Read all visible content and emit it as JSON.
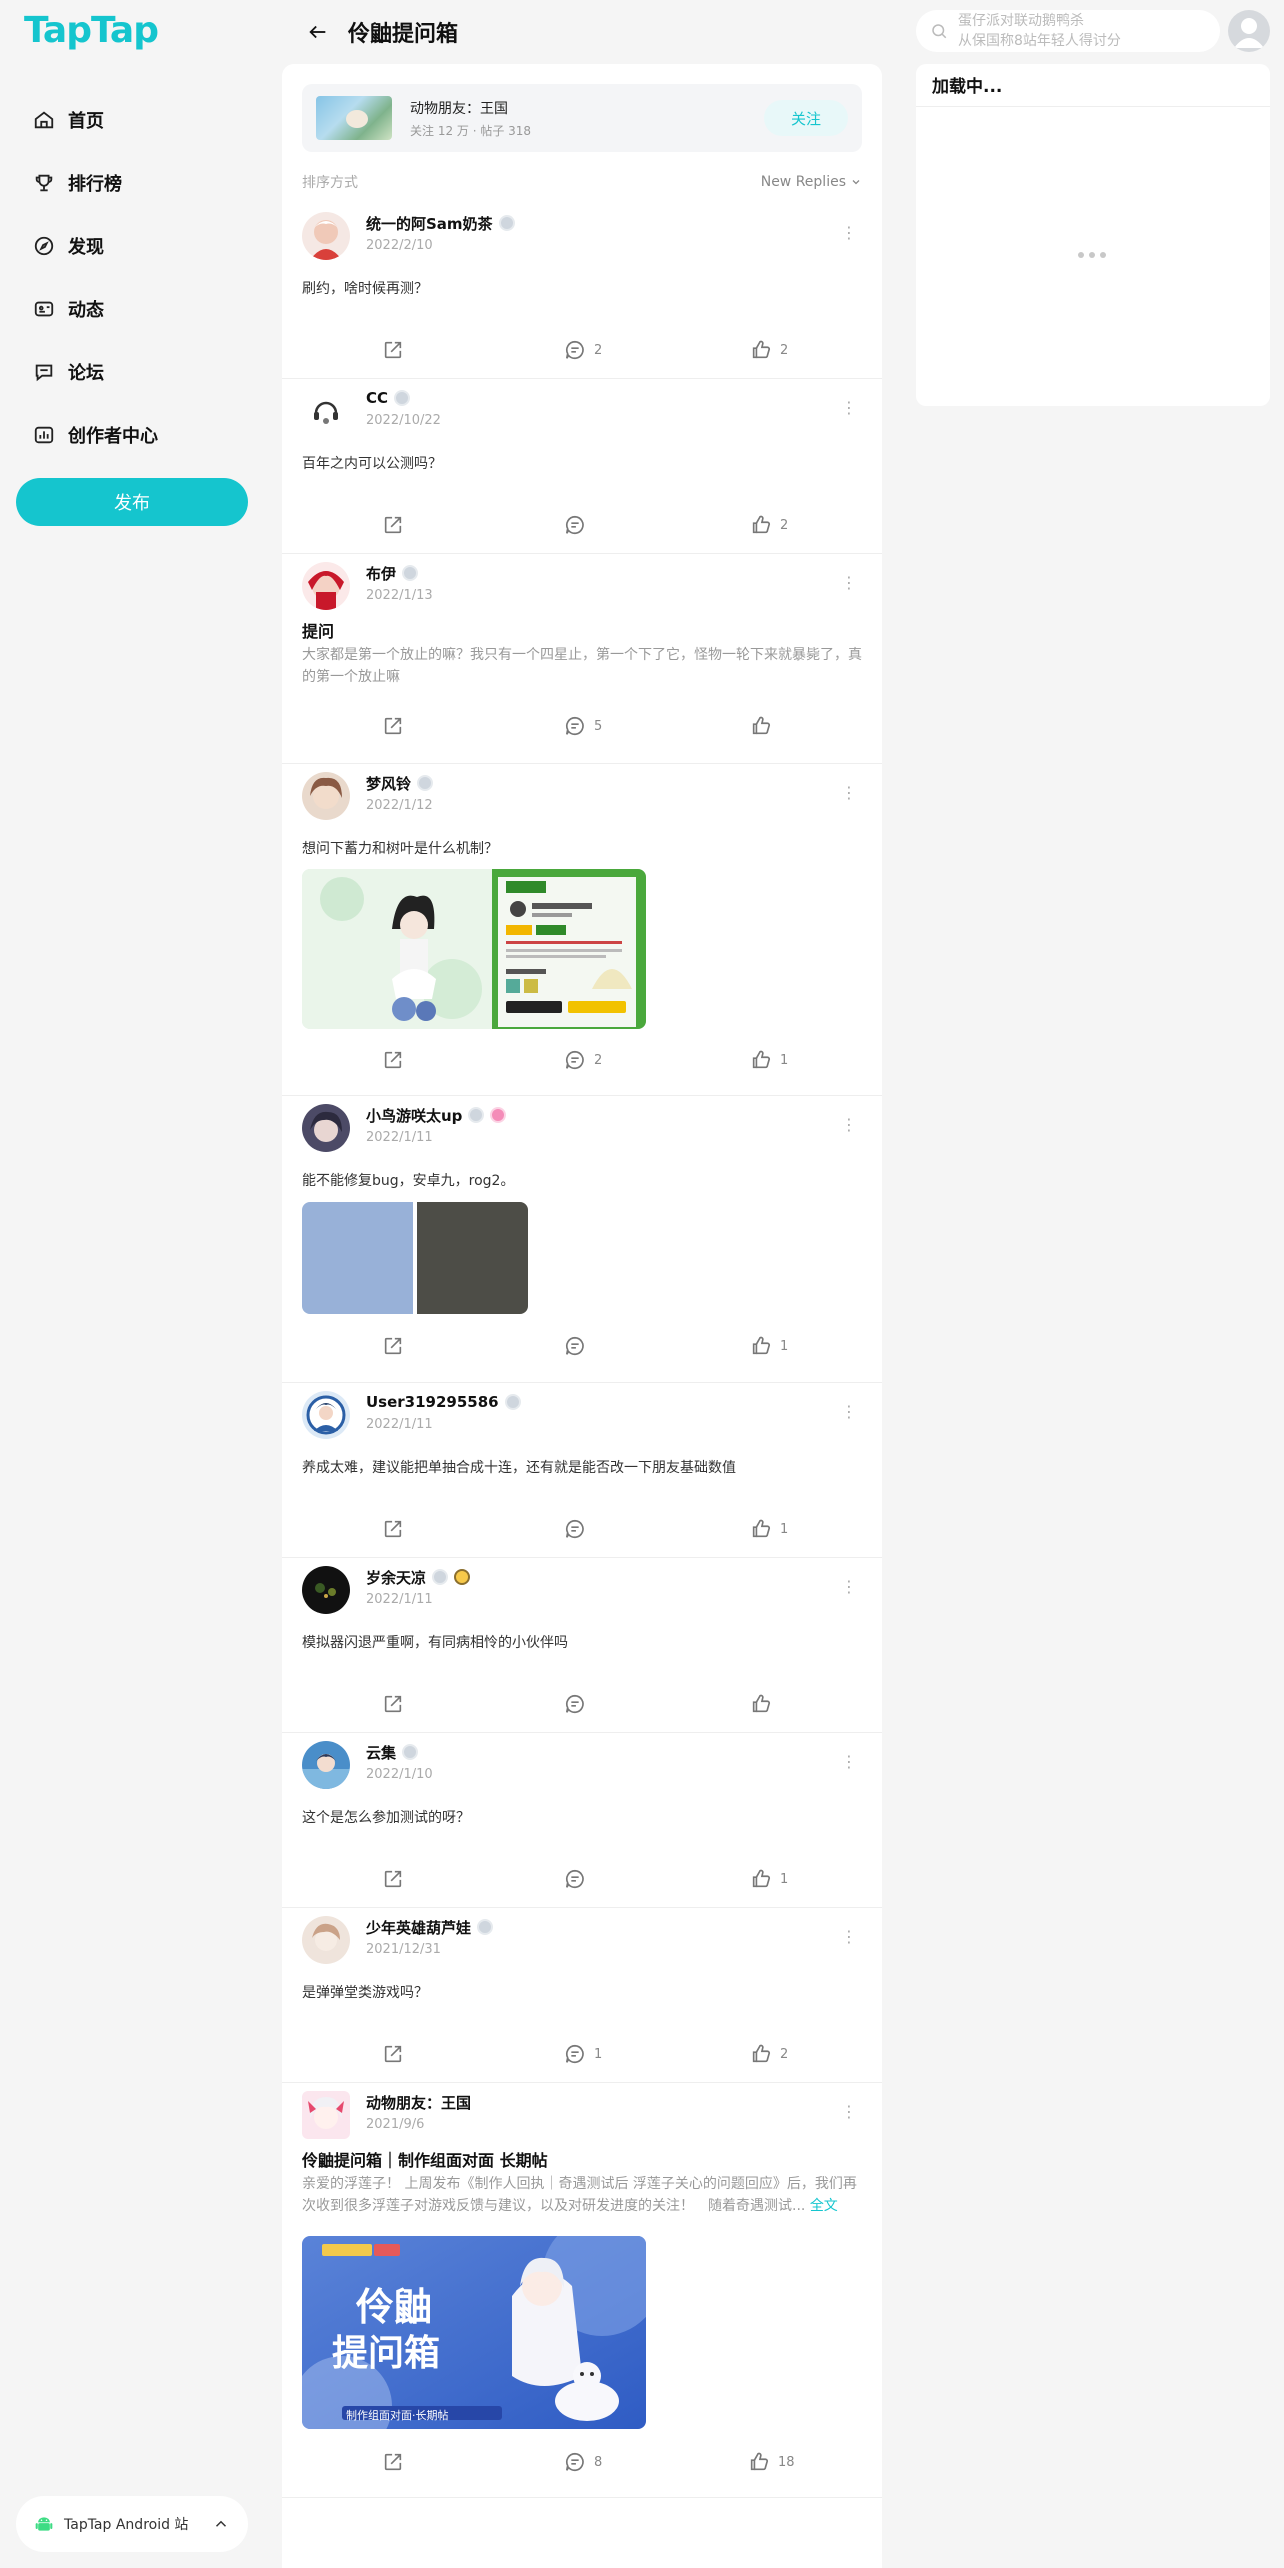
{
  "brand": {
    "logo": "TapTap",
    "accent": "#15c5ce"
  },
  "sidebar": {
    "items": [
      {
        "label": "首页",
        "icon": "home-icon"
      },
      {
        "label": "排行榜",
        "icon": "trophy-icon"
      },
      {
        "label": "发现",
        "icon": "compass-icon"
      },
      {
        "label": "动态",
        "icon": "feed-icon"
      },
      {
        "label": "论坛",
        "icon": "forum-icon"
      },
      {
        "label": "创作者中心",
        "icon": "creator-chart-icon"
      }
    ],
    "publish_label": "发布",
    "android_label": "TapTap Android 站"
  },
  "header": {
    "title": "伶鼬提问箱"
  },
  "forum": {
    "name": "动物朋友：王国",
    "meta": "关注 12 万 · 帖子 318",
    "follow_label": "关注"
  },
  "sort": {
    "label": "排序方式",
    "value": "New Replies"
  },
  "search": {
    "placeholder_line1": "蛋仔派对联动鹅鸭杀",
    "placeholder_line2": "从保国称8站年轻人得讨分"
  },
  "right_panel": {
    "loading_title": "加载中..."
  },
  "posts": [
    {
      "user": "统一的阿Sam奶茶",
      "date": "2022/2/10",
      "title": "",
      "text": "刷约，啥时候再测？",
      "comments": "2",
      "likes": "2"
    },
    {
      "user": "CC",
      "date": "2022/10/22",
      "title": "",
      "text": "百年之内可以公测吗？",
      "comments": "",
      "likes": "2"
    },
    {
      "user": "布伊",
      "date": "2022/1/13",
      "title": "提问",
      "text": "大家都是第一个放止的嘛？我只有一个四星止，第一个下了它，怪物一轮下来就暴毙了，真的第一个放止嘛",
      "comments": "5",
      "likes": ""
    },
    {
      "user": "梦风铃",
      "date": "2022/1/12",
      "title": "",
      "text": "想问下蓄力和树叶是什么机制？",
      "comments": "2",
      "likes": "1"
    },
    {
      "user": "小鸟游咲太up",
      "date": "2022/1/11",
      "title": "",
      "text": "能不能修复bug，安卓九，rog2。",
      "comments": "",
      "likes": "1"
    },
    {
      "user": "User319295586",
      "date": "2022/1/11",
      "title": "",
      "text": "养成太难，建议能把单抽合成十连，还有就是能否改一下朋友基础数值",
      "comments": "",
      "likes": "1"
    },
    {
      "user": "岁余天凉",
      "date": "2022/1/11",
      "title": "",
      "text": "模拟器闪退严重啊，有同病相怜的小伙伴吗",
      "comments": "",
      "likes": ""
    },
    {
      "user": "云集",
      "date": "2022/1/10",
      "title": "",
      "text": "这个是怎么参加测试的呀？",
      "comments": "",
      "likes": "1"
    },
    {
      "user": "少年英雄葫芦娃",
      "date": "2021/12/31",
      "title": "",
      "text": "是弹弹堂类游戏吗？",
      "comments": "1",
      "likes": "2"
    },
    {
      "user": "动物朋友：王国",
      "date": "2021/9/6",
      "title": "伶鼬提问箱｜制作组面对面 长期帖",
      "text": "亲爱的浮莲子！ 上周发布《制作人回执｜奇遇测试后 浮莲子关心的问题回应》后，我们再次收到很多浮莲子对游戏反馈与建议，以及对研发进度的关注！　随着奇遇测试...",
      "fulltext": "全文",
      "comments": "8",
      "likes": "18",
      "banner": {
        "line1": "伶鼬",
        "line2": "提问箱",
        "caption": "制作组面对面·长期帖"
      }
    }
  ]
}
